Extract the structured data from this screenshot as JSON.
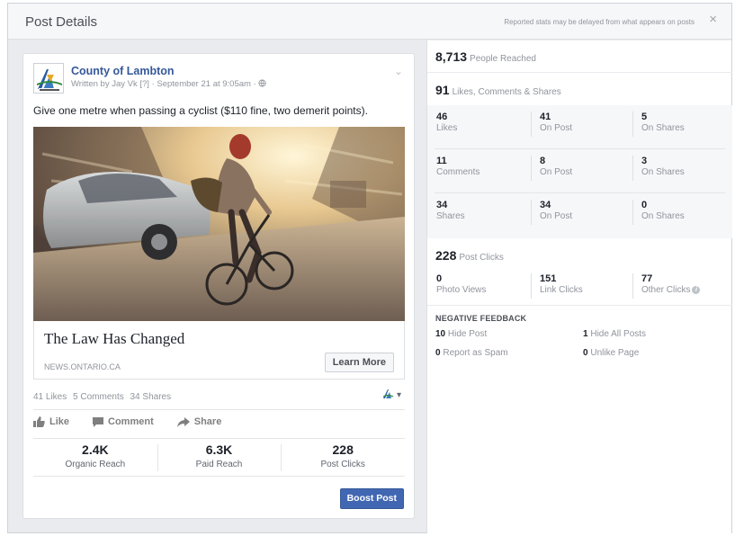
{
  "dialog": {
    "title": "Post Details",
    "note": "Reported stats may be delayed from what appears on posts",
    "close": "×"
  },
  "post": {
    "page_name": "County of Lambton",
    "byline": "Written by Jay Vk [?] · September 21 at 9:05am · ",
    "privacy_icon": "globe-icon",
    "text": "Give one metre when passing a cyclist ($110 fine, two demerit points).",
    "link": {
      "title": "The Law Has Changed",
      "domain": "NEWS.ONTARIO.CA",
      "cta": "Learn More"
    },
    "engagement": {
      "likes": "41 Likes",
      "comments": "5 Comments",
      "shares": "34 Shares"
    },
    "actions": {
      "like": "Like",
      "comment": "Comment",
      "share": "Share"
    },
    "stats": [
      {
        "value": "2.4K",
        "label": "Organic Reach"
      },
      {
        "value": "6.3K",
        "label": "Paid Reach"
      },
      {
        "value": "228",
        "label": "Post Clicks"
      }
    ],
    "boost": "Boost Post"
  },
  "insights": {
    "reached": {
      "value": "8,713",
      "label": "People Reached"
    },
    "engagement": {
      "value": "91",
      "label": "Likes, Comments & Shares"
    },
    "grid": [
      [
        {
          "num": "46",
          "label": "Likes"
        },
        {
          "num": "41",
          "label": "On Post"
        },
        {
          "num": "5",
          "label": "On Shares"
        }
      ],
      [
        {
          "num": "11",
          "label": "Comments"
        },
        {
          "num": "8",
          "label": "On Post"
        },
        {
          "num": "3",
          "label": "On Shares"
        }
      ],
      [
        {
          "num": "34",
          "label": "Shares"
        },
        {
          "num": "34",
          "label": "On Post"
        },
        {
          "num": "0",
          "label": "On Shares"
        }
      ]
    ],
    "clicks": {
      "value": "228",
      "label": "Post Clicks"
    },
    "click_grid": [
      {
        "num": "0",
        "label": "Photo Views"
      },
      {
        "num": "151",
        "label": "Link Clicks"
      },
      {
        "num": "77",
        "label": "Other Clicks"
      }
    ],
    "negative": {
      "title": "NEGATIVE FEEDBACK",
      "items": [
        {
          "num": "10",
          "label": "Hide Post"
        },
        {
          "num": "1",
          "label": "Hide All Posts"
        },
        {
          "num": "0",
          "label": "Report as Spam"
        },
        {
          "num": "0",
          "label": "Unlike Page"
        }
      ]
    }
  },
  "colors": {
    "accent": "#4267b2",
    "link": "#365899",
    "muted": "#90949c"
  }
}
